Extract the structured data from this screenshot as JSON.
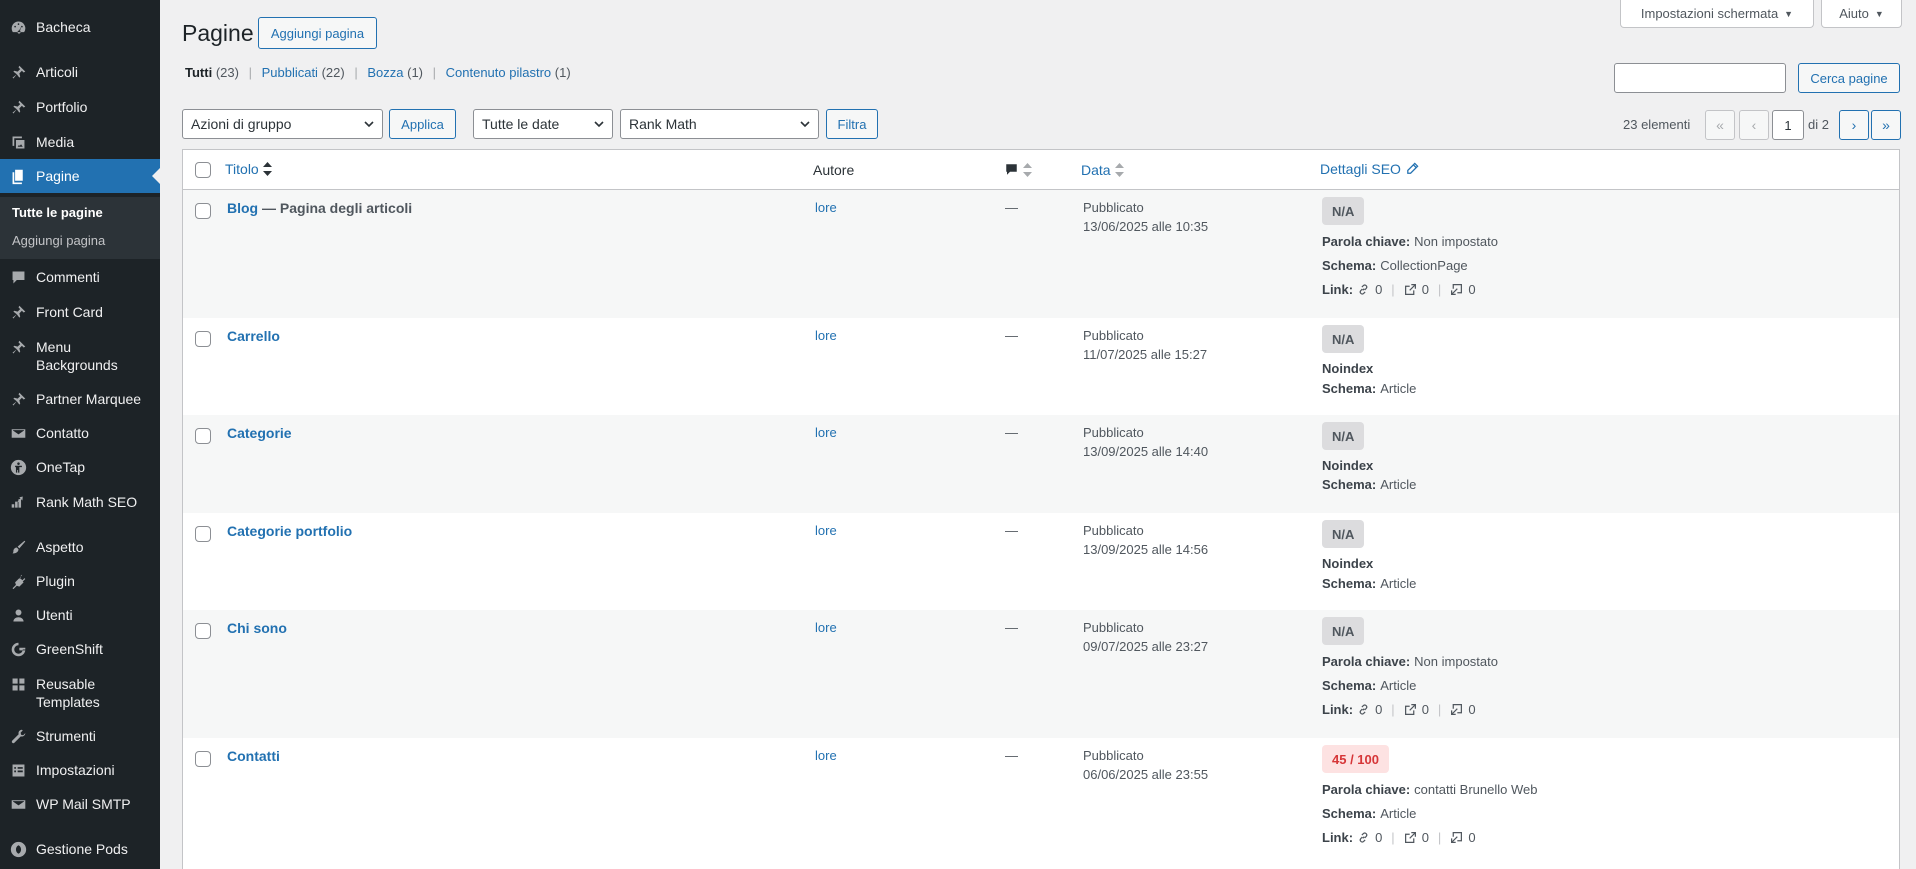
{
  "sidebar": {
    "items": [
      {
        "label": "Bacheca",
        "icon": "dashboard-icon"
      },
      {
        "label": "Articoli",
        "icon": "pin-icon"
      },
      {
        "label": "Portfolio",
        "icon": "pin-icon"
      },
      {
        "label": "Media",
        "icon": "media-icon"
      },
      {
        "label": "Pagine",
        "icon": "pages-icon"
      },
      {
        "label": "Commenti",
        "icon": "comments-icon"
      },
      {
        "label": "Front Card",
        "icon": "pin-icon"
      },
      {
        "label": "Menu Backgrounds",
        "icon": "pin-icon"
      },
      {
        "label": "Partner Marquee",
        "icon": "pin-icon"
      },
      {
        "label": "Contatto",
        "icon": "mail-icon"
      },
      {
        "label": "OneTap",
        "icon": "onetap-icon"
      },
      {
        "label": "Rank Math SEO",
        "icon": "rankmath-icon"
      },
      {
        "label": "Aspetto",
        "icon": "brush-icon"
      },
      {
        "label": "Plugin",
        "icon": "plugin-icon"
      },
      {
        "label": "Utenti",
        "icon": "user-icon"
      },
      {
        "label": "GreenShift",
        "icon": "greenshift-icon"
      },
      {
        "label": "Reusable Templates",
        "icon": "grid-icon"
      },
      {
        "label": "Strumenti",
        "icon": "wrench-icon"
      },
      {
        "label": "Impostazioni",
        "icon": "settings-icon"
      },
      {
        "label": "WP Mail SMTP",
        "icon": "mail-icon"
      },
      {
        "label": "Gestione Pods",
        "icon": "pods-icon"
      }
    ],
    "submenu": [
      "Tutte le pagine",
      "Aggiungi pagina"
    ]
  },
  "header": {
    "title": "Pagine",
    "add_button": "Aggiungi pagina",
    "screen_options": "Impostazioni schermata",
    "help": "Aiuto"
  },
  "filters": {
    "views": [
      {
        "label": "Tutti",
        "count": "(23)"
      },
      {
        "label": "Pubblicati",
        "count": "(22)"
      },
      {
        "label": "Bozza",
        "count": "(1)"
      },
      {
        "label": "Contenuto pilastro",
        "count": "(1)"
      }
    ],
    "bulk_actions": "Azioni di gruppo",
    "apply": "Applica",
    "dates": "Tutte le date",
    "seo_filter": "Rank Math",
    "filter_button": "Filtra",
    "search_button": "Cerca pagine",
    "search_value": ""
  },
  "pagination": {
    "total": "23 elementi",
    "first": "«",
    "prev": "‹",
    "current": "1",
    "of": "di 2",
    "next": "›",
    "last": "»"
  },
  "table": {
    "headers": {
      "title": "Titolo",
      "author": "Autore",
      "date": "Data",
      "seo": "Dettagli SEO"
    },
    "rows": [
      {
        "title": "Blog",
        "suffix": " — Pagina degli articoli",
        "author": "lore",
        "comments": "—",
        "status": "Pubblicato",
        "date": "13/06/2025 alle 10:35",
        "score": "N/A",
        "line1_label": "Parola chiave:",
        "line1_value": "Non impostato",
        "schema_label": "Schema:",
        "schema_value": "CollectionPage",
        "links_label": "Link:",
        "links": [
          "0",
          "0",
          "0"
        ]
      },
      {
        "title": "Carrello",
        "suffix": "",
        "author": "lore",
        "comments": "—",
        "status": "Pubblicato",
        "date": "11/07/2025 alle 15:27",
        "score": "N/A",
        "line1_label": "Noindex",
        "line1_value": "",
        "schema_label": "Schema:",
        "schema_value": "Article"
      },
      {
        "title": "Categorie",
        "suffix": "",
        "author": "lore",
        "comments": "—",
        "status": "Pubblicato",
        "date": "13/09/2025 alle 14:40",
        "score": "N/A",
        "line1_label": "Noindex",
        "line1_value": "",
        "schema_label": "Schema:",
        "schema_value": "Article"
      },
      {
        "title": "Categorie portfolio",
        "suffix": "",
        "author": "lore",
        "comments": "—",
        "status": "Pubblicato",
        "date": "13/09/2025 alle 14:56",
        "score": "N/A",
        "line1_label": "Noindex",
        "line1_value": "",
        "schema_label": "Schema:",
        "schema_value": "Article"
      },
      {
        "title": "Chi sono",
        "suffix": "",
        "author": "lore",
        "comments": "—",
        "status": "Pubblicato",
        "date": "09/07/2025 alle 23:27",
        "score": "N/A",
        "line1_label": "Parola chiave:",
        "line1_value": "Non impostato",
        "schema_label": "Schema:",
        "schema_value": "Article",
        "links_label": "Link:",
        "links": [
          "0",
          "0",
          "0"
        ]
      },
      {
        "title": "Contatti",
        "suffix": "",
        "author": "lore",
        "comments": "—",
        "status": "Pubblicato",
        "date": "06/06/2025 alle 23:55",
        "score": "45 / 100",
        "line1_label": "Parola chiave:",
        "line1_value": "contatti Brunello Web",
        "schema_label": "Schema:",
        "schema_value": "Article",
        "links_label": "Link:",
        "links": [
          "0",
          "0",
          "0"
        ]
      }
    ]
  }
}
